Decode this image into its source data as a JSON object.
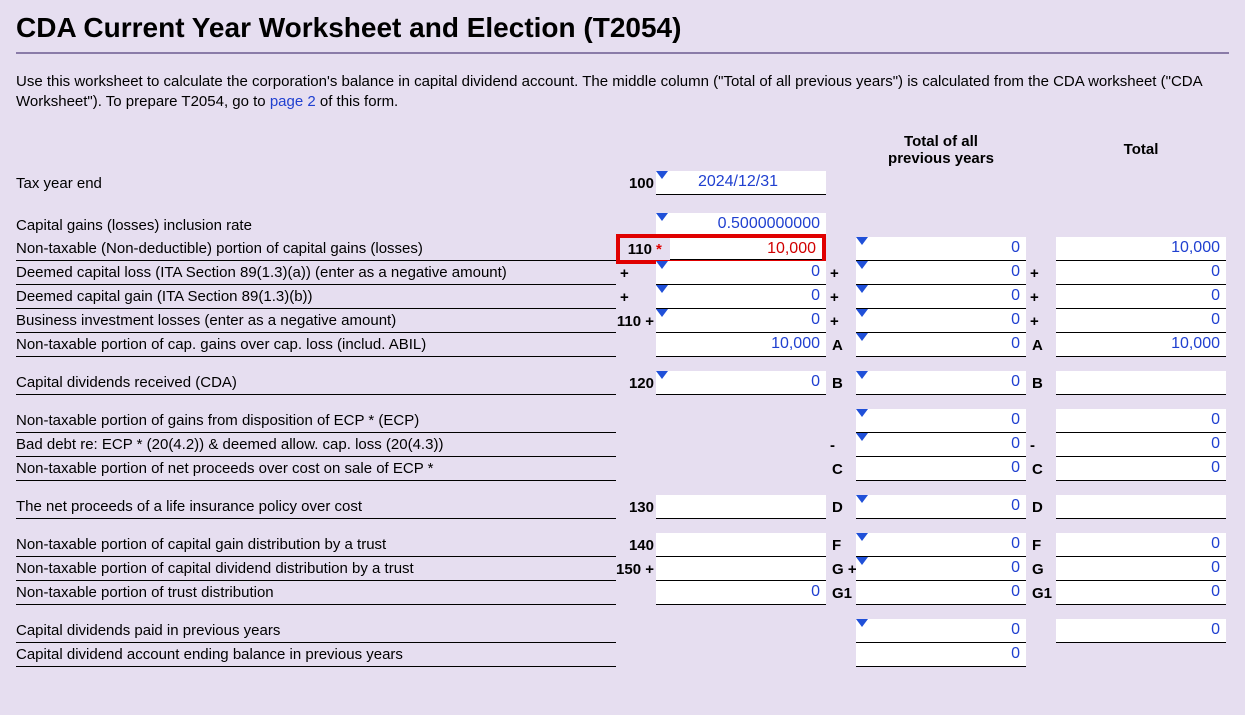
{
  "title": "CDA Current Year Worksheet and Election (T2054)",
  "intro_part1": "Use this worksheet to calculate the corporation's balance in capital dividend account. The middle column (\"Total of all previous years\") is calculated from the CDA worksheet (\"CDA Worksheet\"). To prepare T2054, go to ",
  "intro_link": "page 2",
  "intro_part2": " of this form.",
  "headers": {
    "prev": "Total of all\nprevious years",
    "total": "Total"
  },
  "rows": {
    "taxyear": {
      "label": "Tax year end",
      "code": "100",
      "val": "2024/12/31"
    },
    "inclrate": {
      "label": "Capital gains (losses) inclusion rate",
      "val": "0.5000000000"
    },
    "nontax_cg": {
      "label": "Non-taxable (Non-deductible) portion of capital gains (losses)",
      "code": "110",
      "val": "10,000",
      "prev": "0",
      "total": "10,000"
    },
    "deemed_loss": {
      "label": "Deemed capital loss (ITA Section 89(1.3)(a)) (enter as a negative amount)",
      "op": "+",
      "val": "0",
      "prev": "0",
      "total": "0"
    },
    "deemed_gain": {
      "label": "Deemed capital gain (ITA Section 89(1.3)(b))",
      "op": "+",
      "val": "0",
      "prev": "0",
      "total": "0"
    },
    "bil": {
      "label": "Business investment losses (enter as a negative amount)",
      "code": "110",
      "op": "+",
      "val": "0",
      "prev": "0",
      "total": "0"
    },
    "nontax_over": {
      "label": "Non-taxable portion of cap. gains over cap. loss (includ. ABIL)",
      "val": "10,000",
      "letterP": "A",
      "prev": "0",
      "letterT": "A",
      "total": "10,000"
    },
    "capdiv_recv": {
      "label": "Capital dividends received (CDA)",
      "code": "120",
      "val": "0",
      "letterP": "B",
      "prev": "0",
      "letterT": "B"
    },
    "ecp_gain": {
      "label": "Non-taxable portion of gains from disposition of ECP * (ECP)",
      "prev": "0",
      "total": "0"
    },
    "baddebt": {
      "label": "Bad debt re: ECP * (20(4.2)) & deemed allow. cap. loss (20(4.3))",
      "opP": "-",
      "prev": "0",
      "opT": "-",
      "total": "0"
    },
    "ecp_net": {
      "label": "Non-taxable portion of net proceeds over cost on sale of ECP *",
      "letterP": "C",
      "prev": "0",
      "letterT": "C",
      "total": "0"
    },
    "life": {
      "label": "The net proceeds of a life insurance policy over cost",
      "code": "130",
      "letterP": "D",
      "prev": "0",
      "letterT": "D"
    },
    "trust_cg": {
      "label": "Non-taxable portion of capital gain distribution by a trust",
      "code": "140",
      "letterP": "F",
      "prev": "0",
      "letterT": "F",
      "total": "0"
    },
    "trust_cd": {
      "label": "Non-taxable portion of capital dividend distribution by a trust",
      "code": "150",
      "op": "+",
      "letterP": "G",
      "opP": "+",
      "prev": "0",
      "letterT": "G",
      "total": "0"
    },
    "trust_dist": {
      "label": "Non-taxable portion of trust distribution",
      "val": "0",
      "letterP": "G1",
      "prev": "0",
      "letterT": "G1",
      "total": "0"
    },
    "divpaid": {
      "label": "Capital dividends paid in previous years",
      "prev": "0",
      "total": "0"
    },
    "ending": {
      "label": "Capital dividend account ending balance in previous years",
      "prev": "0"
    }
  }
}
